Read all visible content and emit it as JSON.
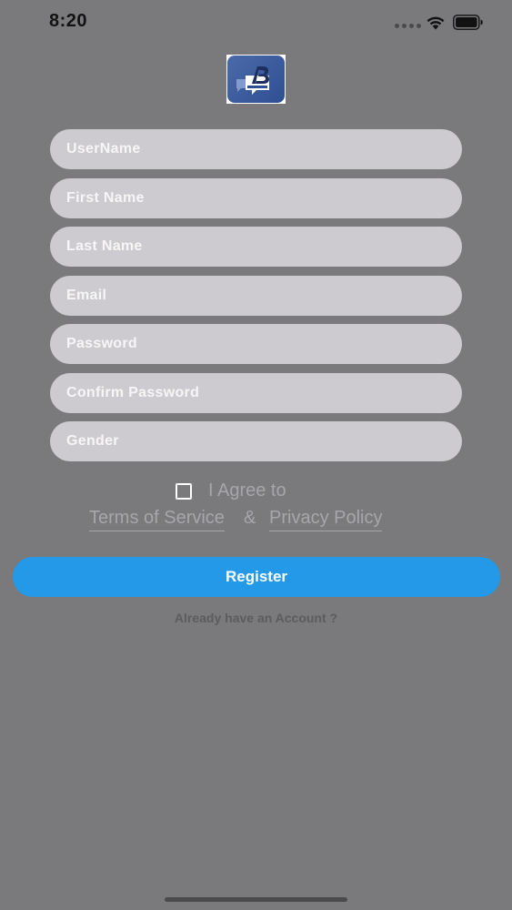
{
  "status_bar": {
    "time": "8:20"
  },
  "form": {
    "fields": [
      {
        "placeholder": "UserName"
      },
      {
        "placeholder": "First Name"
      },
      {
        "placeholder": "Last Name"
      },
      {
        "placeholder": "Email"
      },
      {
        "placeholder": "Password"
      },
      {
        "placeholder": "Confirm Password"
      },
      {
        "placeholder": "Gender"
      }
    ]
  },
  "agreement": {
    "label": "I Agree to",
    "checked": false,
    "terms_link": "Terms of Service",
    "ampersand": "&",
    "privacy_link": "Privacy Policy"
  },
  "register_button": {
    "label": "Register"
  },
  "login_prompt": "Already have an Account ?",
  "colors": {
    "background": "#7a797c",
    "field": "#cdcbcf",
    "accent": "#2399e8"
  }
}
